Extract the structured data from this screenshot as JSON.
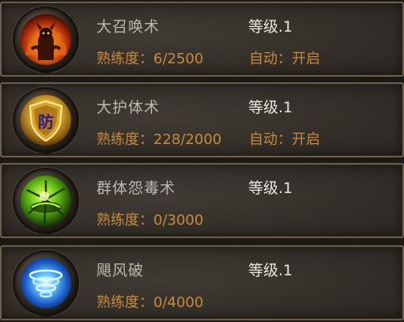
{
  "skills": [
    {
      "name": "大召唤术",
      "level": "等级.1",
      "proficiency": "熟练度：6/2500",
      "auto": "自动：开启",
      "icon": "fire-demon-icon"
    },
    {
      "name": "大护体术",
      "level": "等级.1",
      "proficiency": "熟练度：228/2000",
      "auto": "自动：开启",
      "icon": "defense-shield-icon",
      "icon_text": "防"
    },
    {
      "name": "群体怨毒术",
      "level": "等级.1",
      "proficiency": "熟练度：0/3000",
      "icon": "poison-burst-icon"
    },
    {
      "name": "飓风破",
      "level": "等级.1",
      "proficiency": "熟练度：0/4000",
      "icon": "cyclone-icon"
    }
  ],
  "colors": {
    "name_text": "#c0b8ac",
    "level_text": "#ece6dc",
    "proficiency_text": "#c88a3c"
  }
}
